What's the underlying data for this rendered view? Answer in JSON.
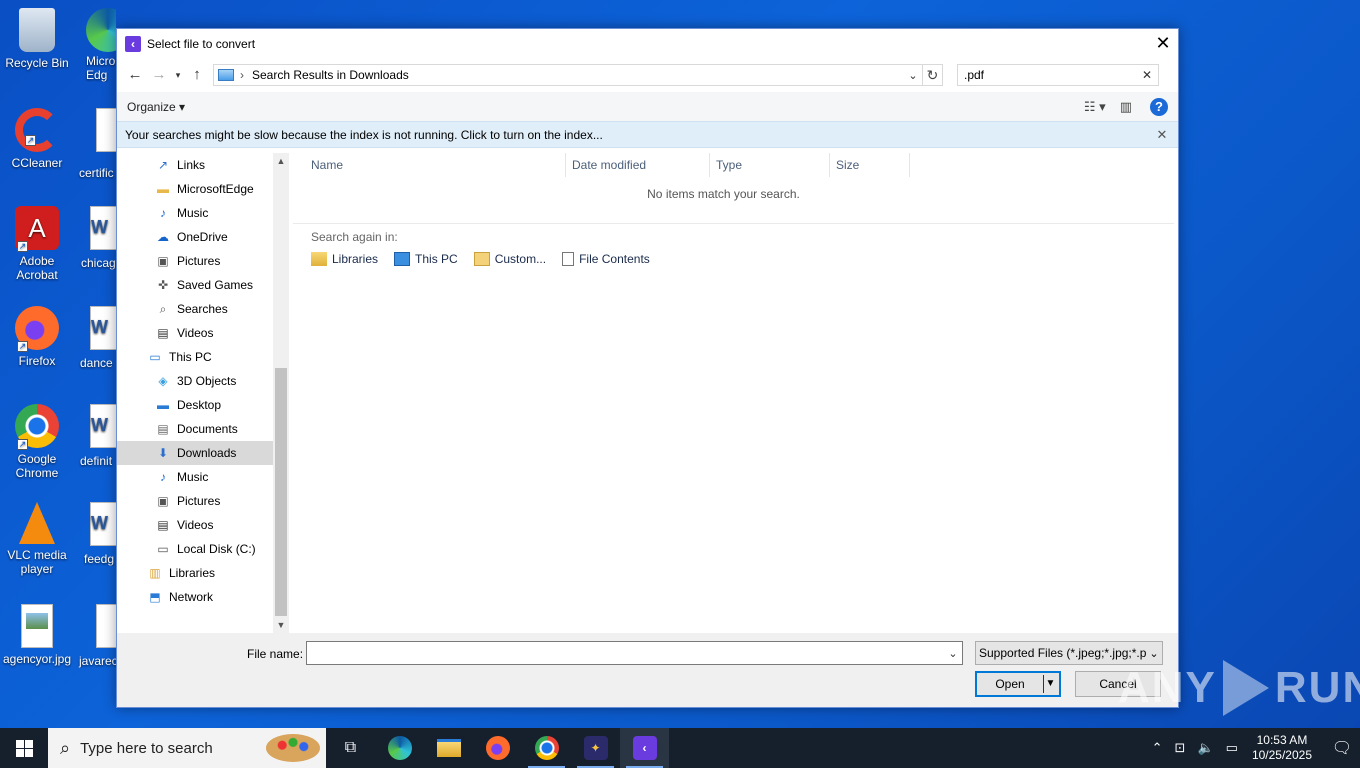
{
  "desktop": {
    "icons": [
      {
        "label": "Recycle Bin"
      },
      {
        "label": "CCleaner"
      },
      {
        "label": "Adobe Acrobat"
      },
      {
        "label": "Firefox"
      },
      {
        "label": "Google Chrome"
      },
      {
        "label": "VLC media player"
      },
      {
        "label": "agencyor.jpg"
      }
    ],
    "icons_col2": [
      {
        "label": "Micro Edg"
      },
      {
        "label": "certific"
      },
      {
        "label": "chicag"
      },
      {
        "label": "dance"
      },
      {
        "label": "definit"
      },
      {
        "label": "feedg"
      },
      {
        "label": "javarec"
      }
    ]
  },
  "dialog": {
    "title": "Select file to convert",
    "close_glyph": "✕",
    "address": {
      "path": "Search Results in Downloads"
    },
    "search": {
      "value": ".pdf"
    },
    "toolbar": {
      "organize": "Organize ▾"
    },
    "infobar": {
      "message": "Your searches might be slow because the index is not running.  Click to turn on the index..."
    },
    "nav": {
      "items": [
        {
          "label": "Links",
          "icon": "links-icon",
          "indent": 2
        },
        {
          "label": "MicrosoftEdge",
          "icon": "folder-icon",
          "indent": 2
        },
        {
          "label": "Music",
          "icon": "music-icon",
          "indent": 2
        },
        {
          "label": "OneDrive",
          "icon": "onedrive-icon",
          "indent": 2
        },
        {
          "label": "Pictures",
          "icon": "pictures-icon",
          "indent": 2
        },
        {
          "label": "Saved Games",
          "icon": "saved-games-icon",
          "indent": 2
        },
        {
          "label": "Searches",
          "icon": "searches-icon",
          "indent": 2
        },
        {
          "label": "Videos",
          "icon": "videos-icon",
          "indent": 2
        },
        {
          "label": "This PC",
          "icon": "this-pc-icon",
          "indent": 1
        },
        {
          "label": "3D Objects",
          "icon": "3d-objects-icon",
          "indent": 2
        },
        {
          "label": "Desktop",
          "icon": "desktop-icon",
          "indent": 2
        },
        {
          "label": "Documents",
          "icon": "documents-icon",
          "indent": 2
        },
        {
          "label": "Downloads",
          "icon": "downloads-icon",
          "indent": 2,
          "selected": true
        },
        {
          "label": "Music",
          "icon": "music-icon",
          "indent": 2
        },
        {
          "label": "Pictures",
          "icon": "pictures-icon",
          "indent": 2
        },
        {
          "label": "Videos",
          "icon": "videos-icon",
          "indent": 2
        },
        {
          "label": "Local Disk (C:)",
          "icon": "local-disk-icon",
          "indent": 2
        },
        {
          "label": "Libraries",
          "icon": "libraries-icon",
          "indent": 1
        },
        {
          "label": "Network",
          "icon": "network-icon",
          "indent": 1
        }
      ]
    },
    "columns": [
      "Name",
      "Date modified",
      "Type",
      "Size"
    ],
    "empty_message": "No items match your search.",
    "search_again": {
      "label": "Search again in:",
      "links": [
        "Libraries",
        "This PC",
        "Custom...",
        "File Contents"
      ]
    },
    "footer": {
      "file_name_label": "File name:",
      "file_name_value": "",
      "filter": "Supported Files (*.jpeg;*.jpg;*.p",
      "open": "Open",
      "cancel": "Cancel"
    }
  },
  "watermark": {
    "left": "ANY",
    "right": "RUN"
  },
  "taskbar": {
    "search_placeholder": "Type here to search",
    "clock_time": "10:53 AM",
    "clock_date": "10/25/2025"
  },
  "colors": {
    "accent": "#0078d7",
    "selected_nav": "#d9d9d9",
    "infobar": "#e0eef9",
    "taskbar": "#16202d"
  }
}
